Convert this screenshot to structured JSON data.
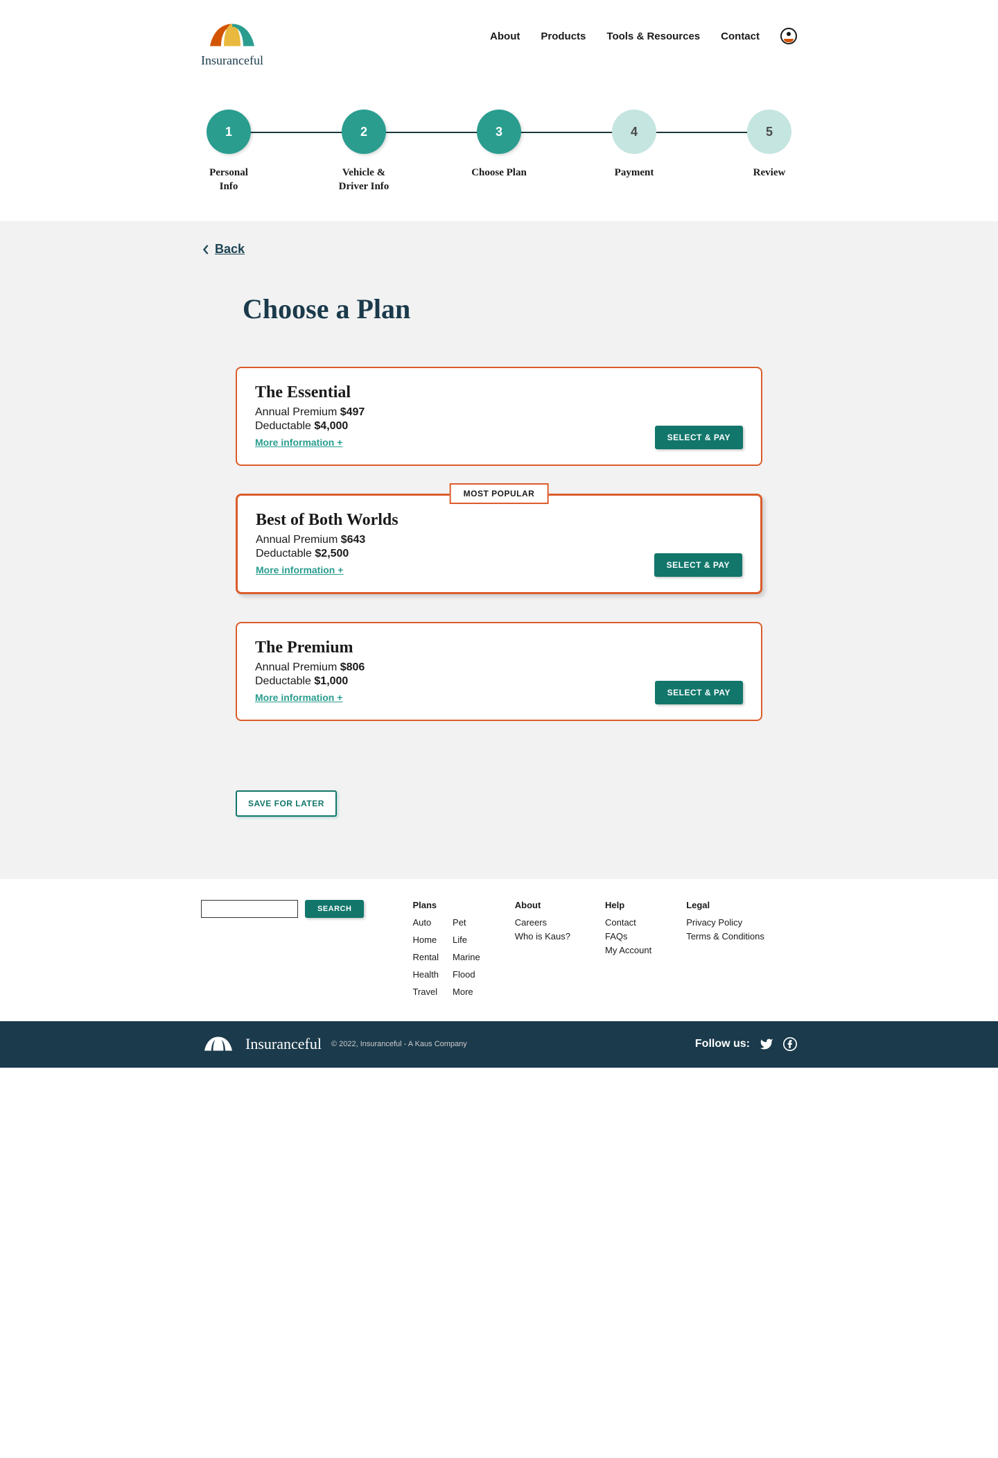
{
  "brand": {
    "name": "Insuranceful",
    "copyright": "© 2022, Insuranceful - A Kaus Company"
  },
  "nav": {
    "about": "About",
    "products": "Products",
    "tools": "Tools & Resources",
    "contact": "Contact"
  },
  "stepper": {
    "steps": [
      {
        "num": "1",
        "label": "Personal Info"
      },
      {
        "num": "2",
        "label": "Vehicle & Driver Info"
      },
      {
        "num": "3",
        "label": "Choose Plan"
      },
      {
        "num": "4",
        "label": "Payment"
      },
      {
        "num": "5",
        "label": "Review"
      }
    ]
  },
  "page": {
    "back": "Back",
    "title": "Choose a Plan",
    "premium_label": "Annual Premium",
    "deductible_label": "Deductable",
    "more_info": "More information +",
    "select_btn": "SELECT & PAY",
    "popular_badge": "MOST POPULAR",
    "save_later": "SAVE FOR LATER"
  },
  "plans": [
    {
      "name": "The Essential",
      "premium": "$497",
      "deductible": "$4,000",
      "popular": false
    },
    {
      "name": "Best of Both Worlds",
      "premium": "$643",
      "deductible": "$2,500",
      "popular": true
    },
    {
      "name": "The Premium",
      "premium": "$806",
      "deductible": "$1,000",
      "popular": false
    }
  ],
  "footer": {
    "search_btn": "SEARCH",
    "plans_heading": "Plans",
    "plan_links": [
      "Auto",
      "Pet",
      "Home",
      "Life",
      "Rental",
      "Marine",
      "Health",
      "Flood",
      "Travel",
      "More"
    ],
    "about_heading": "About",
    "about_links": [
      "Careers",
      "Who is Kaus?"
    ],
    "help_heading": "Help",
    "help_links": [
      "Contact",
      "FAQs",
      "My Account"
    ],
    "legal_heading": "Legal",
    "legal_links": [
      "Privacy Policy",
      "Terms & Conditions"
    ],
    "follow": "Follow us:"
  }
}
